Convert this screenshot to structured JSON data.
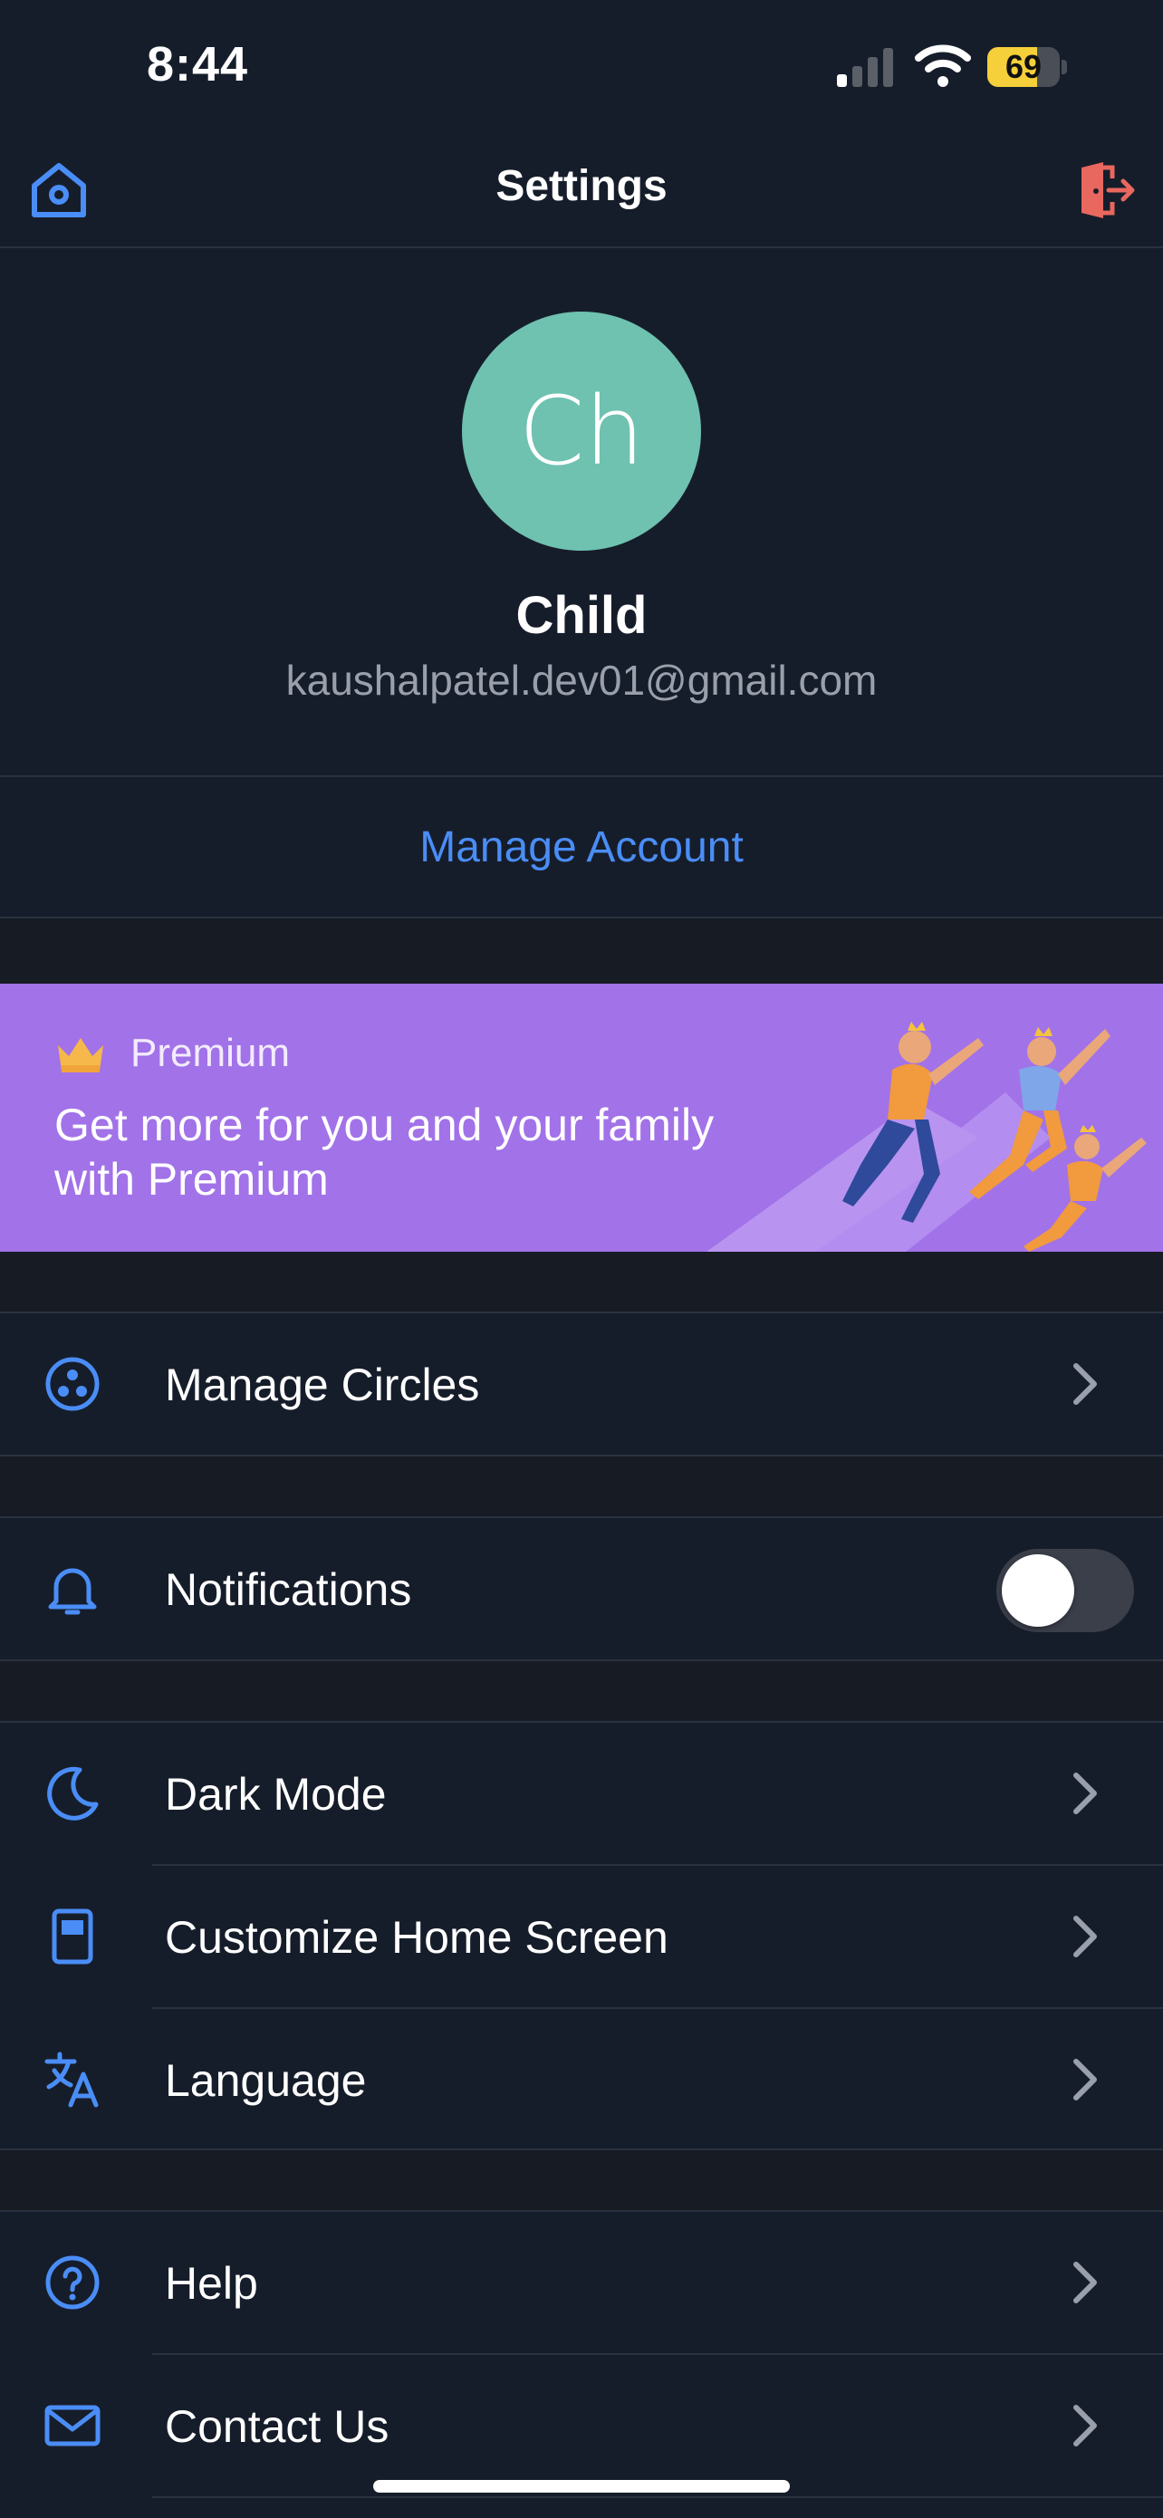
{
  "status_bar": {
    "time": "8:44",
    "battery_level": "69",
    "battery_fraction": 0.69,
    "battery_color": "#f5d03b"
  },
  "header": {
    "title": "Settings",
    "left_icon": "home-icon",
    "right_icon": "exit-icon"
  },
  "profile": {
    "initials": "Ch",
    "name": "Child",
    "email": "kaushalpatel.dev01@gmail.com",
    "avatar_color": "#6fc1b0"
  },
  "manage_account": {
    "label": "Manage Account"
  },
  "premium": {
    "label": "Premium",
    "text": "Get more for you and your family with Premium",
    "background": "#a272e8"
  },
  "sections": {
    "circles": {
      "label": "Manage Circles",
      "icon": "circles-icon"
    },
    "notifications": {
      "label": "Notifications",
      "icon": "bell-icon",
      "enabled": false
    },
    "display": [
      {
        "label": "Dark Mode",
        "icon": "moon-icon"
      },
      {
        "label": "Customize Home Screen",
        "icon": "phone-screen-icon"
      },
      {
        "label": "Language",
        "icon": "translate-icon"
      }
    ],
    "support": [
      {
        "label": "Help",
        "icon": "question-icon"
      },
      {
        "label": "Contact Us",
        "icon": "mail-icon"
      }
    ]
  },
  "colors": {
    "accent": "#4a8df6",
    "background": "#161b24",
    "surface": "#161d2a",
    "exit_icon": "#e8675f"
  }
}
